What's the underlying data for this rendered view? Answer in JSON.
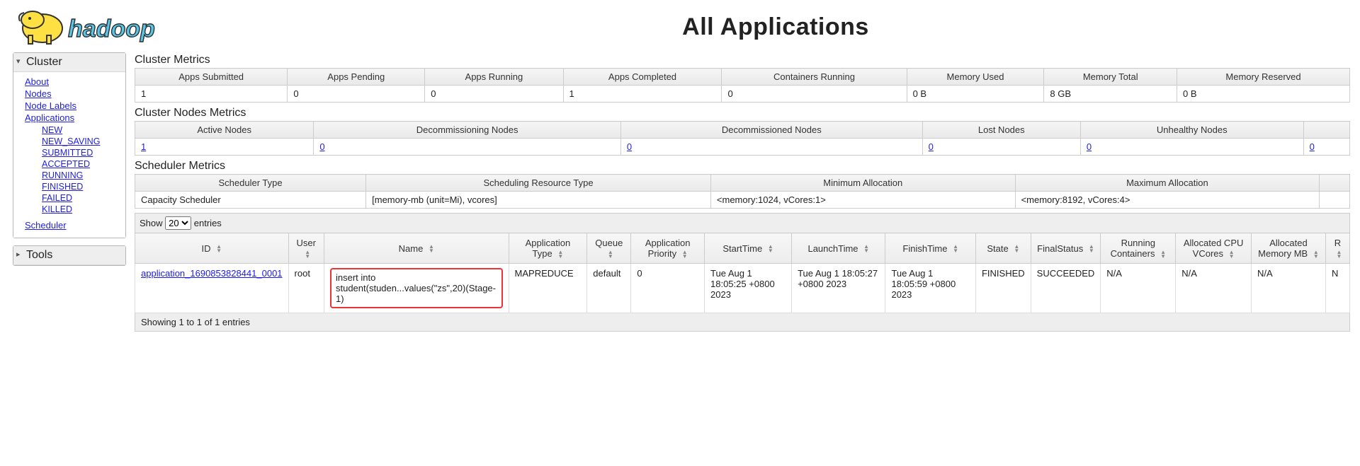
{
  "header": {
    "title": "All Applications",
    "logo_text": "hadoop"
  },
  "sidebar": {
    "cluster_label": "Cluster",
    "tools_label": "Tools",
    "items": [
      {
        "label": "About",
        "indent": 1
      },
      {
        "label": "Nodes",
        "indent": 1
      },
      {
        "label": "Node Labels",
        "indent": 1
      },
      {
        "label": "Applications",
        "indent": 1
      },
      {
        "label": "NEW",
        "indent": 2
      },
      {
        "label": "NEW_SAVING",
        "indent": 2
      },
      {
        "label": "SUBMITTED",
        "indent": 2
      },
      {
        "label": "ACCEPTED",
        "indent": 2
      },
      {
        "label": "RUNNING",
        "indent": 2
      },
      {
        "label": "FINISHED",
        "indent": 2
      },
      {
        "label": "FAILED",
        "indent": 2
      },
      {
        "label": "KILLED",
        "indent": 2
      },
      {
        "label": "Scheduler",
        "indent": 1
      }
    ]
  },
  "sections": {
    "cluster_metrics": "Cluster Metrics",
    "cluster_nodes": "Cluster Nodes Metrics",
    "scheduler_metrics": "Scheduler Metrics"
  },
  "cluster_metrics": {
    "headers": [
      "Apps Submitted",
      "Apps Pending",
      "Apps Running",
      "Apps Completed",
      "Containers Running",
      "Memory Used",
      "Memory Total",
      "Memory Reserved"
    ],
    "values": [
      "1",
      "0",
      "0",
      "1",
      "0",
      "0 B",
      "8 GB",
      "0 B"
    ]
  },
  "cluster_nodes": {
    "headers": [
      "Active Nodes",
      "Decommissioning Nodes",
      "Decommissioned Nodes",
      "Lost Nodes",
      "Unhealthy Nodes",
      ""
    ],
    "values": [
      "1",
      "0",
      "0",
      "0",
      "0",
      "0"
    ]
  },
  "scheduler_metrics": {
    "headers": [
      "Scheduler Type",
      "Scheduling Resource Type",
      "Minimum Allocation",
      "Maximum Allocation",
      ""
    ],
    "values": [
      "Capacity Scheduler",
      "[memory-mb (unit=Mi), vcores]",
      "<memory:1024, vCores:1>",
      "<memory:8192, vCores:4>",
      ""
    ]
  },
  "datatable": {
    "show_prefix": "Show",
    "show_suffix": "entries",
    "page_len": "20",
    "columns": [
      "ID",
      "User",
      "Name",
      "Application Type",
      "Queue",
      "Application Priority",
      "StartTime",
      "LaunchTime",
      "FinishTime",
      "State",
      "FinalStatus",
      "Running Containers",
      "Allocated CPU VCores",
      "Allocated Memory MB",
      "R"
    ],
    "row": {
      "id": "application_1690853828441_0001",
      "user": "root",
      "name": "insert into student(studen...values(\"zs\",20)(Stage-1)",
      "type": "MAPREDUCE",
      "queue": "default",
      "priority": "0",
      "start": "Tue Aug 1 18:05:25 +0800 2023",
      "launch": "Tue Aug 1 18:05:27 +0800 2023",
      "finish": "Tue Aug 1 18:05:59 +0800 2023",
      "state": "FINISHED",
      "final": "SUCCEEDED",
      "running": "N/A",
      "vcores": "N/A",
      "mem": "N/A",
      "extra": "N"
    },
    "status": "Showing 1 to 1 of 1 entries"
  }
}
